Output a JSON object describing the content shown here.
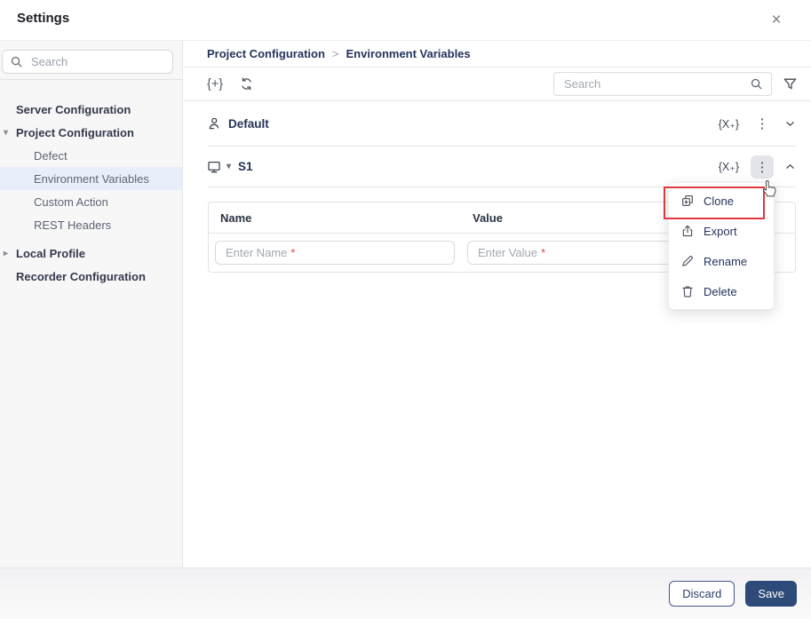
{
  "window": {
    "title": "Settings",
    "close_glyph": "×"
  },
  "colors": {
    "accent_navy": "#26345e",
    "selected_item_bg": "#e9effa",
    "highlight_red": "#e2383d",
    "save_button_bg": "#2e4a78",
    "required_red": "#e14b4b"
  },
  "sidebar": {
    "search_placeholder": "Search",
    "items": [
      {
        "label": "Server Configuration"
      },
      {
        "label": "Project Configuration",
        "caret": "▾"
      },
      {
        "label": "Defect"
      },
      {
        "label": "Environment Variables"
      },
      {
        "label": "Custom Action"
      },
      {
        "label": "REST Headers"
      },
      {
        "label": "Local Profile",
        "caret": "▸"
      },
      {
        "label": "Recorder Configuration"
      }
    ]
  },
  "main": {
    "breadcrumb": {
      "parent": "Project Configuration",
      "separator": ">",
      "current": "Environment Variables"
    },
    "toolbar": {
      "add_glyph": "{+}",
      "search_placeholder": "Search"
    },
    "groups": [
      {
        "name": "Default",
        "add_glyph": "{X₊}",
        "kebab_glyph": "⋮",
        "state": "collapsed"
      },
      {
        "name": "S1",
        "caret": "▾",
        "add_glyph": "{X₊}",
        "kebab_glyph": "⋮",
        "state": "expanded"
      }
    ],
    "table": {
      "name_header": "Name",
      "value_header": "Value",
      "name_placeholder": "Enter Name",
      "value_placeholder": "Enter Value",
      "required_marker": "*"
    },
    "menu": {
      "items": [
        {
          "label": "Clone",
          "highlighted": true
        },
        {
          "label": "Export"
        },
        {
          "label": "Rename"
        },
        {
          "label": "Delete"
        }
      ]
    }
  },
  "footer": {
    "discard_label": "Discard",
    "save_label": "Save"
  }
}
